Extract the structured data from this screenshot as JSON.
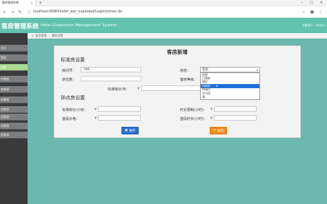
{
  "browser": {
    "tab_title": "客房管理系统",
    "url": "localhost:8080/hotel_war_exploded/Login/toman.do"
  },
  "header": {
    "title_cn": "客房管理系统",
    "title_en": "Hotel Guestroom Management System",
    "welcome": "当前用户：admin"
  },
  "sidebar": {
    "items": [
      "会计",
      "管理",
      "设置",
      "房管理",
      "房管理",
      "房管理",
      "房管理",
      "房管理",
      "房管理",
      "房管理"
    ]
  },
  "breadcrumb": {
    "home": "首页管理",
    "current": "客房设置"
  },
  "form": {
    "title": "客房新增",
    "standard_section": "标准房设置",
    "hourly_section": "钟点房设置",
    "room_no_label": "房间号：",
    "room_no_value": "789",
    "floor_label": "床位数：",
    "floor_value": "",
    "std_price_label": "标准房价/天：",
    "std_price_value": "",
    "status_label": "房态：",
    "status_value": "空房",
    "room_type_label": "客房等级：",
    "hourly_price_label": "标准房价/小时：",
    "hourly_price_value": "",
    "first_price_label": "首段价格：",
    "first_price_value": "",
    "duration_label": "时长限制(小时)：",
    "duration_value": "",
    "first_duration_label": "首段时长(小时)：",
    "first_duration_value": "",
    "currency": "¥",
    "save_label": "保存",
    "back_label": "返回"
  },
  "status_options": [
    "空房",
    "已预房",
    "预定",
    "待退房",
    "待清扫",
    "不可用",
    "满"
  ],
  "status_highlight_index": 3,
  "colors": {
    "header": "#62c2b0",
    "content": "#6bb8ae",
    "save": "#2b6fd0",
    "back": "#f58c1f"
  }
}
